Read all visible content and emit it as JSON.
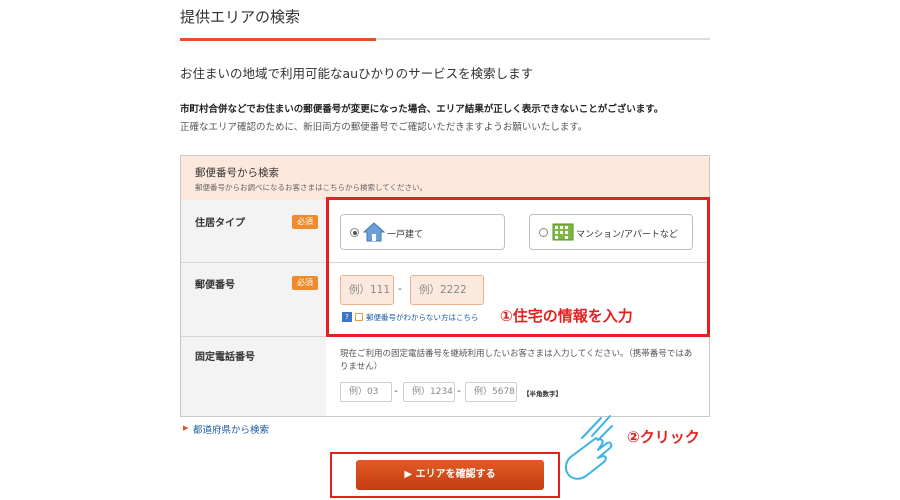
{
  "header": {
    "title": "提供エリアの検索"
  },
  "intro": {
    "subtitle": "お住まいの地域で利用可能なauひかりのサービスを検索します",
    "notice_bold": "市町村合併などでお住まいの郵便番号が変更になった場合、エリア結果が正しく表示できないことがございます。",
    "notice": "正確なエリア確認のために、新旧両方の郵便番号でご確認いただきますようお願いいたします。"
  },
  "form": {
    "title": "郵便番号から検索",
    "subtitle": "郵便番号からお調べになるお客さまはこちらから検索してください。",
    "required_badge": "必須",
    "residence": {
      "label": "住居タイプ",
      "options": [
        {
          "label": "一戸建て",
          "selected": true,
          "icon": "house-icon"
        },
        {
          "label": "マンション/アパートなど",
          "selected": false,
          "icon": "apartment-icon"
        }
      ]
    },
    "zip": {
      "label": "郵便番号",
      "placeholder1": "例）111",
      "placeholder2": "例）2222",
      "separator": "-",
      "help_link": "郵便番号がわからない方はこちら"
    },
    "phone": {
      "label": "固定電話番号",
      "note": "現在ご利用の固定電話番号を継続利用したいお客さまは入力してください。（携帯番号ではありません）",
      "placeholder1": "例）03",
      "placeholder2": "例）1234",
      "placeholder3": "例）5678",
      "separator": "-",
      "half_width_note": "【半角数字】"
    }
  },
  "links": {
    "prefecture": "都道府県から検索"
  },
  "submit": {
    "label": "▶ エリアを確認する"
  },
  "annotations": {
    "step1": "①住宅の情報を入力",
    "step2": "②クリック"
  },
  "colors": {
    "accent": "#e8501e",
    "annotation_red": "#e5211f",
    "required_badge": "#f08a2a",
    "hand_icon": "#3bb3e6"
  }
}
